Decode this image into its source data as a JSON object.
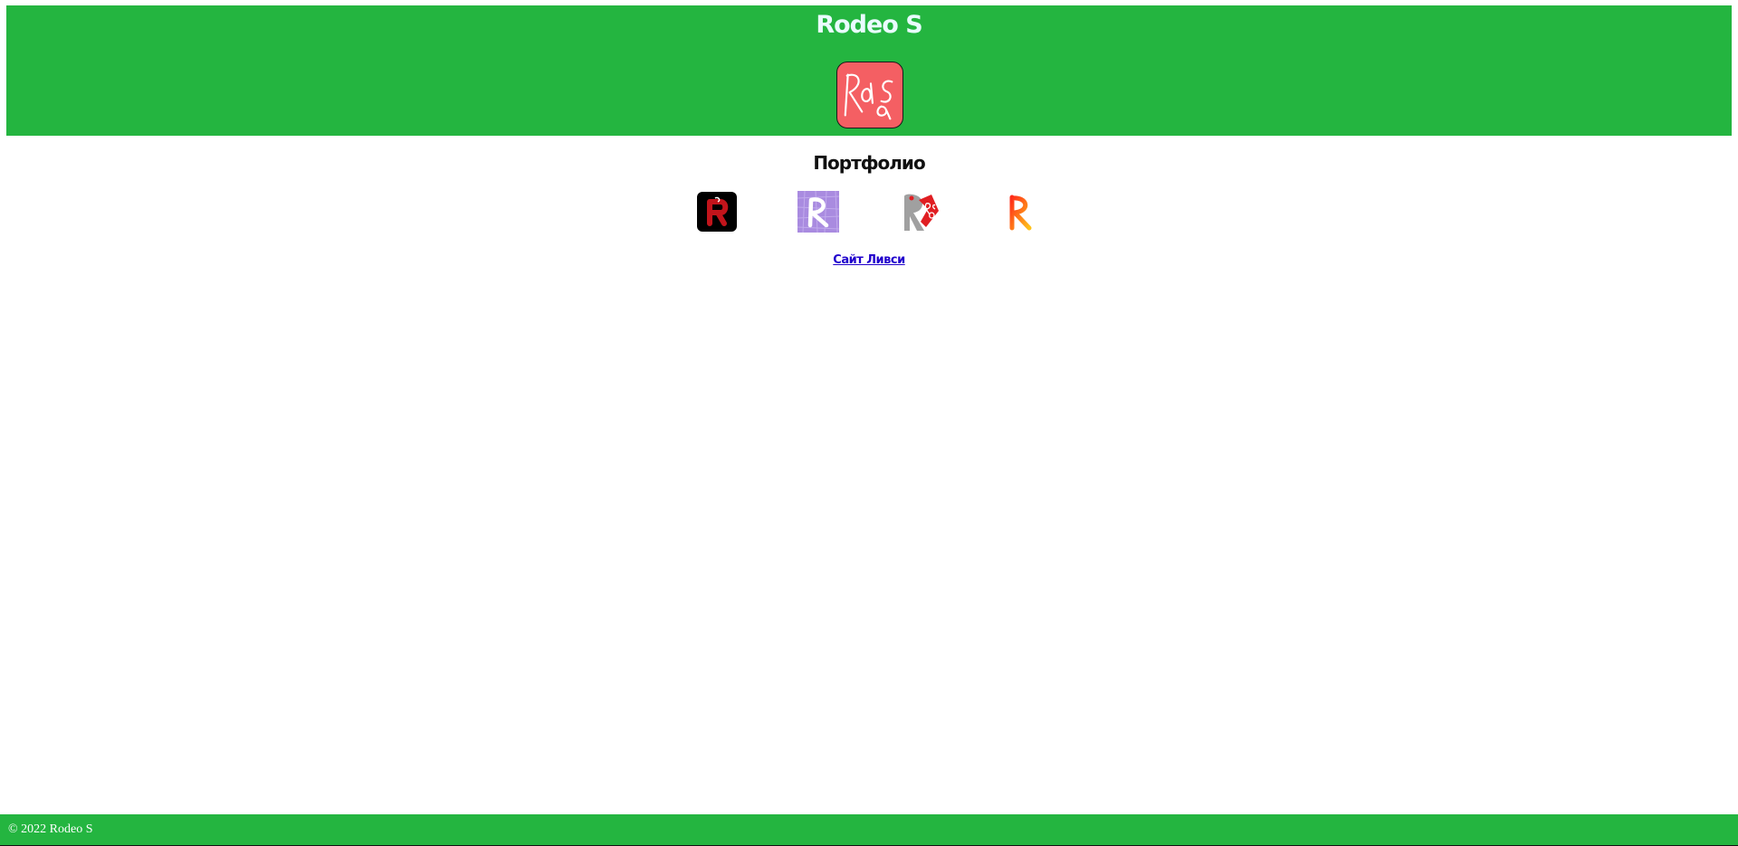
{
  "header": {
    "title": "Rodeo S",
    "background_color": "#24b540",
    "logo": {
      "icon": "rodeo-s-logo-icon",
      "color": "#f45f63"
    }
  },
  "portfolio": {
    "title": "Портфолио",
    "items": [
      {
        "icon": "portfolio-red-r-dark-icon",
        "color": "#000000"
      },
      {
        "icon": "portfolio-white-r-purple-icon",
        "color": "#a98be0"
      },
      {
        "icon": "portfolio-grey-r-rodeo-icon",
        "color": "#a0a0a0"
      },
      {
        "icon": "portfolio-gradient-r-icon",
        "color": "#ff5a14"
      }
    ]
  },
  "links": {
    "livsi_site": "Сайт Ливси"
  },
  "footer": {
    "copyright": "© 2022 Rodeo S",
    "background_color": "#24b540"
  }
}
